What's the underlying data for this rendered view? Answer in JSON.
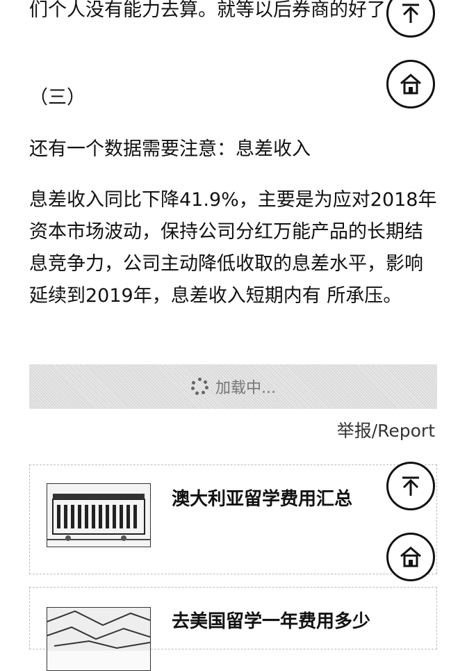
{
  "article": {
    "paragraphs": [
      "们个人没有能力去算。就等以后券商的好了。",
      "（三）",
      "还有一个数据需要注意：息差收入",
      "息差收入同比下降41.9%，主要是为应对2018年资本市场波动，保持公司分红万能产品的长期结息竞争力，公司主动降低收取的息差水平，影响延续到2019年，息差收入短期内有 所承压。"
    ]
  },
  "loading": {
    "label": "加载中..."
  },
  "report": {
    "label": "举报/Report"
  },
  "recommendations": [
    {
      "title": "澳大利亚留学费用汇总"
    },
    {
      "title": "去美国留学一年费用多少"
    }
  ],
  "floating_buttons": {
    "top_icon": "back-to-top-icon",
    "home_icon": "home-icon"
  }
}
